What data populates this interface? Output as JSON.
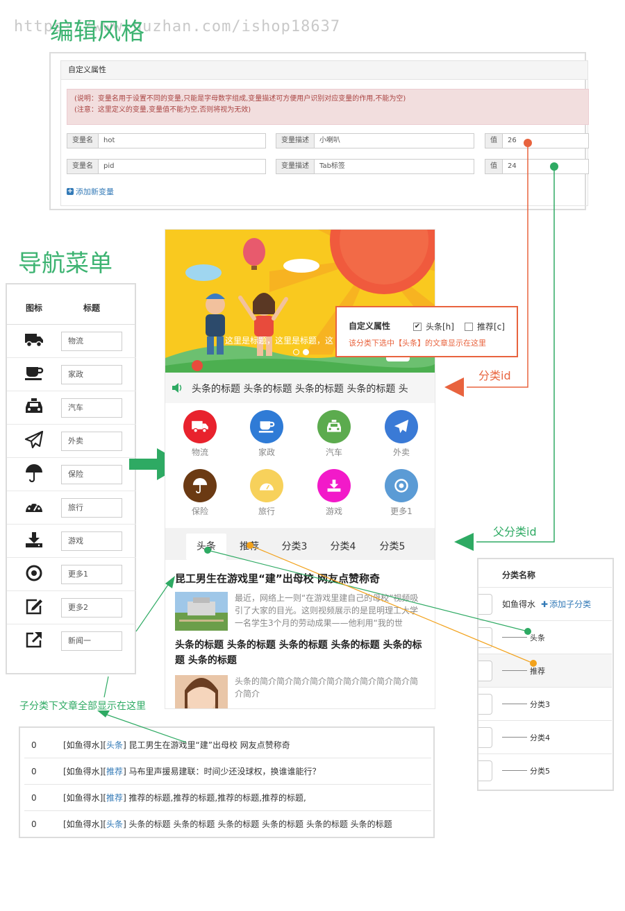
{
  "watermark": "https://www.huzhan.com/ishop18637",
  "section_edit_style": "编辑风格",
  "section_nav_menu": "导航菜单",
  "custom_attr_panel": {
    "title": "自定义属性",
    "note_line1": "(说明：变量名用于设置不同的变量,只能是字母数字组成,变量描述可方便用户识别对应变量的作用,不能为空)",
    "note_line2": "(注意：这里定义的变量,变量值不能为空,否则将视为无效)",
    "var_name_label": "变量名",
    "var_desc_label": "变量描述",
    "value_label": "值",
    "rows": [
      {
        "name": "hot",
        "desc": "小喇叭",
        "value": "26"
      },
      {
        "name": "pid",
        "desc": "Tab标签",
        "value": "24"
      }
    ],
    "add_var": "添加新变量"
  },
  "nav_table": {
    "col_icon": "图标",
    "col_title": "标题",
    "rows": [
      {
        "icon": "truck-icon",
        "title": "物流"
      },
      {
        "icon": "coffee-cup-icon",
        "title": "家政"
      },
      {
        "icon": "taxi-icon",
        "title": "汽车"
      },
      {
        "icon": "paper-plane-icon",
        "title": "外卖"
      },
      {
        "icon": "umbrella-icon",
        "title": "保险"
      },
      {
        "icon": "dashboard-icon",
        "title": "旅行"
      },
      {
        "icon": "download-icon",
        "title": "游戏"
      },
      {
        "icon": "target-icon",
        "title": "更多1"
      },
      {
        "icon": "edit-icon",
        "title": "更多2"
      },
      {
        "icon": "external-link-icon",
        "title": "新闻一"
      }
    ]
  },
  "phone": {
    "banner_caption": "这里是标题，这里是标题，这",
    "ticker": "头条的标题 头条的标题 头条的标题 头条的标题 头",
    "categories": [
      {
        "label": "物流",
        "icon": "truck-icon",
        "color": "#e8222d"
      },
      {
        "label": "家政",
        "icon": "coffee-cup-icon",
        "color": "#2f7bd6"
      },
      {
        "label": "汽车",
        "icon": "taxi-icon",
        "color": "#5cab4e"
      },
      {
        "label": "外卖",
        "icon": "paper-plane-icon",
        "color": "#3a7ad6"
      },
      {
        "label": "保险",
        "icon": "umbrella-icon",
        "color": "#6b3a13"
      },
      {
        "label": "旅行",
        "icon": "dashboard-icon",
        "color": "#f7d15b"
      },
      {
        "label": "游戏",
        "icon": "download-icon",
        "color": "#f21ac9"
      },
      {
        "label": "更多1",
        "icon": "target-icon",
        "color": "#5b9bd5"
      }
    ],
    "tabs": [
      "头条",
      "推荐",
      "分类3",
      "分类4",
      "分类5"
    ],
    "articles": [
      {
        "title": "昆工男生在游戏里“建”出母校 网友点赞称奇",
        "summary": "最近，网络上一则“在游戏里建自己的母校”视频吸引了大家的目光。这则视频展示的是昆明理工大学一名学生3个月的劳动成果——他利用“我的世"
      },
      {
        "title": "头条的标题 头条的标题 头条的标题 头条的标题 头条的标题 头条的标题",
        "summary": "头条的简介简介简介简介简介简介简介简介简介简介简介"
      }
    ]
  },
  "popup": {
    "label": "自定义属性",
    "option_headline": "头条[h]",
    "option_recommend": "推荐[c]",
    "headline_checked": true,
    "recommend_checked": false,
    "hint": "该分类下选中【头条】的文章显示在这里"
  },
  "annotations": {
    "category_id": "分类id",
    "parent_category_id": "父分类id",
    "subcategory_articles": "子分类下文章全部显示在这里"
  },
  "category_tree": {
    "header": "分类名称",
    "root": "如鱼得水",
    "add_child": "添加子分类",
    "children": [
      "头条",
      "推荐",
      "分类3",
      "分类4",
      "分类5"
    ]
  },
  "article_list": [
    {
      "num": "0",
      "prefix": "[如鱼得水][",
      "tag": "头条",
      "suffix": "] 昆工男生在游戏里“建”出母校 网友点赞称奇"
    },
    {
      "num": "0",
      "prefix": "[如鱼得水][",
      "tag": "推荐",
      "suffix": "] 马布里声援易建联：时间少还没球权，换谁谁能行？"
    },
    {
      "num": "0",
      "prefix": "[如鱼得水][",
      "tag": "推荐",
      "suffix": "] 推荐的标题,推荐的标题,推荐的标题,推荐的标题,"
    },
    {
      "num": "0",
      "prefix": "[如鱼得水][",
      "tag": "头条",
      "suffix": "] 头条的标题 头条的标题 头条的标题 头条的标题 头条的标题 头条的标题"
    }
  ]
}
